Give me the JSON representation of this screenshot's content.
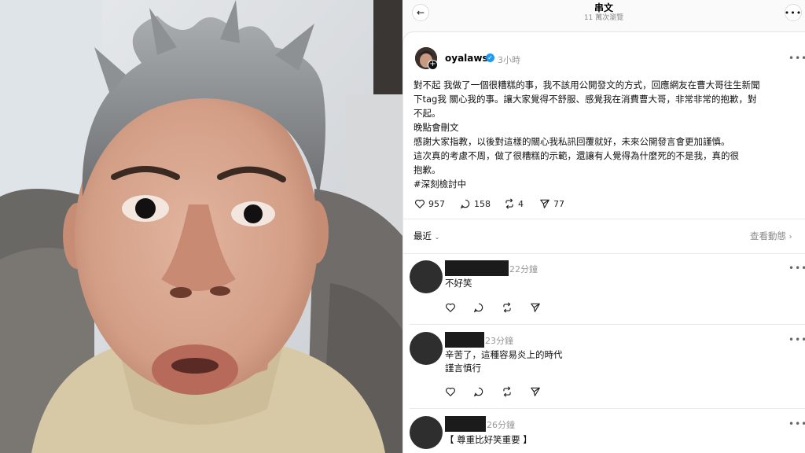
{
  "topbar": {
    "title": "串文",
    "views": "11 萬次瀏覽",
    "back_icon": "back-arrow-icon",
    "more_icon": "more-dots-icon"
  },
  "post": {
    "author": "oyalaws",
    "time": "3小時",
    "lines": [
      "對不起 我做了一個很糟糕的事，我不該用公開發文的方式，回應網友在曹大哥往生新聞",
      "下tag我 關心我的事。讓大家覺得不舒服、感覺我在消費曹大哥，非常非常的抱歉，對",
      "不起。",
      "晚點會刪文",
      "感謝大家指教，以後對這樣的關心我私訊回覆就好，未來公開發言會更加謹慎。",
      "這次真的考慮不周，做了很糟糕的示範，還讓有人覺得為什麼死的不是我，真的很",
      "抱歉。",
      "#深刻檢討中"
    ],
    "likes": "957",
    "comments": "158",
    "reposts": "4",
    "shares": "77"
  },
  "sort": {
    "label": "最近",
    "activity": "查看動態"
  },
  "comments": [
    {
      "time": "22分鐘",
      "lines": [
        "不好笑"
      ]
    },
    {
      "time": "23分鐘",
      "lines": [
        "辛苦了，這種容易炎上的時代",
        "謹言慎行"
      ]
    },
    {
      "time": "26分鐘",
      "lines": [
        "【 尊重比好笑重要 】"
      ]
    }
  ],
  "colors": {
    "verified": "#1d9bf0",
    "muted": "#999999",
    "redaction": "#1b1b1b"
  }
}
